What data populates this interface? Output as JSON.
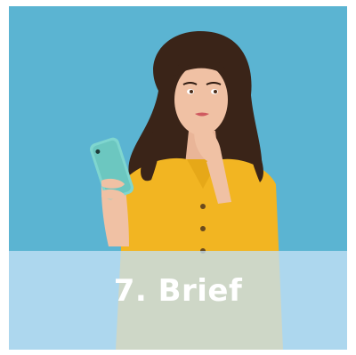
{
  "card": {
    "caption": "7. Brief",
    "background_color": "#5fb8d6",
    "overlay_color": "#c4e0f6",
    "text_color": "#ffffff"
  },
  "photo": {
    "subject": "woman-holding-phone-thinking",
    "shirt_color": "#f2b522",
    "phone_color": "#7fd6cf",
    "hair_color": "#3a2418"
  }
}
